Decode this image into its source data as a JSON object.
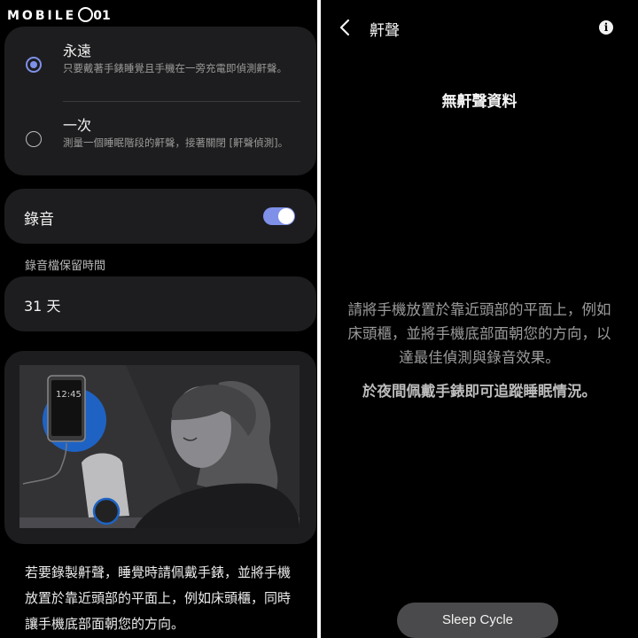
{
  "watermark": {
    "brand": "MOBILE",
    "suffix": "01"
  },
  "left": {
    "options": [
      {
        "title": "永遠",
        "desc": "只要戴著手錶睡覺且手機在一旁充電即偵測鼾聲。",
        "selected": true
      },
      {
        "title": "一次",
        "desc": "測量一個睡眠階段的鼾聲，接著關閉 [鼾聲偵測]。",
        "selected": false
      }
    ],
    "recording": {
      "label": "錄音",
      "enabled": true
    },
    "retention": {
      "section_label": "錄音檔保留時間",
      "value": "31 天"
    },
    "illustration": {
      "phone_time": "12:45"
    },
    "body_text": "若要錄製鼾聲，睡覺時請佩戴手錶，並將手機放置於靠近頭部的平面上，例如床頭櫃，同時讓手機底部面朝您的方向。"
  },
  "right": {
    "header": {
      "title": "鼾聲",
      "back_icon": "chevron-left-icon",
      "info_icon": "info-icon"
    },
    "no_data": "無鼾聲資料",
    "hint": "請將手機放置於靠近頭部的平面上，例如床頭櫃，並將手機底部面朝您的方向，以達最佳偵測與錄音效果。",
    "hint2": "於夜間佩戴手錶即可追蹤睡眠情況。",
    "bottom_button": "Sleep Cycle"
  },
  "colors": {
    "accent": "#7e90e8",
    "card": "#1d1d1f",
    "background": "#000000"
  }
}
